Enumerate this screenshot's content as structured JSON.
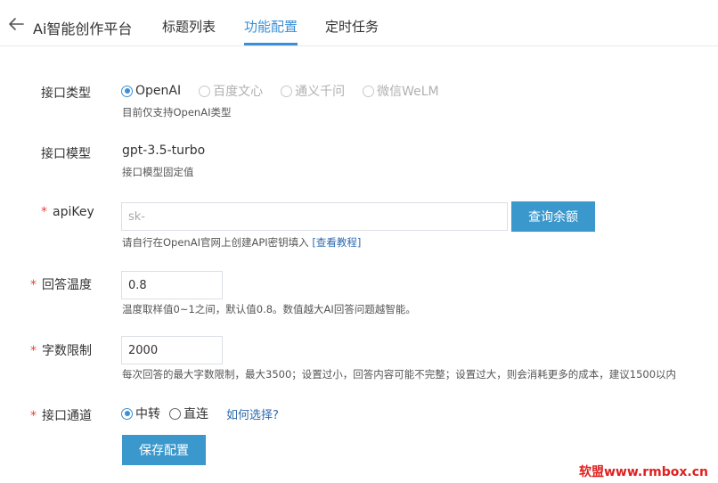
{
  "header": {
    "app_title": "Ai智能创作平台",
    "tabs": [
      {
        "label": "标题列表"
      },
      {
        "label": "功能配置"
      },
      {
        "label": "定时任务"
      }
    ],
    "active_tab": "功能配置",
    "accent_color": "#3b8fd6"
  },
  "form": {
    "api_type": {
      "label": "接口类型",
      "options": [
        "OpenAI",
        "百度文心",
        "通义千问",
        "微信WeLM"
      ],
      "selected": "OpenAI",
      "hint": "目前仅支持OpenAI类型"
    },
    "api_model": {
      "label": "接口模型",
      "value": "gpt-3.5-turbo",
      "hint": "接口模型固定值"
    },
    "api_key": {
      "label": "apiKey",
      "required": "*",
      "value": "sk-",
      "hint_text": "请自行在OpenAI官网上创建API密钥填入",
      "hint_link": "[查看教程]",
      "query_button": "查询余额"
    },
    "temperature": {
      "label": "回答温度",
      "required": "*",
      "value": "0.8",
      "hint": "温度取样值0~1之间，默认值0.8。数值越大AI回答问题越智能。"
    },
    "word_limit": {
      "label": "字数限制",
      "required": "*",
      "value": "2000",
      "hint": "每次回答的最大字数限制，最大3500；设置过小，回答内容可能不完整；设置过大，则会消耗更多的成本，建议1500以内"
    },
    "channel": {
      "label": "接口通道",
      "required": "*",
      "options": [
        "中转",
        "直连"
      ],
      "selected": "中转",
      "help_link": "如何选择?"
    },
    "save_button": "保存配置"
  },
  "watermark": "软盟www.rmbox.cn",
  "colors": {
    "button": "#3b98cd",
    "required": "#e6453b",
    "link": "#2d6ab0",
    "watermark": "#e0201f"
  }
}
